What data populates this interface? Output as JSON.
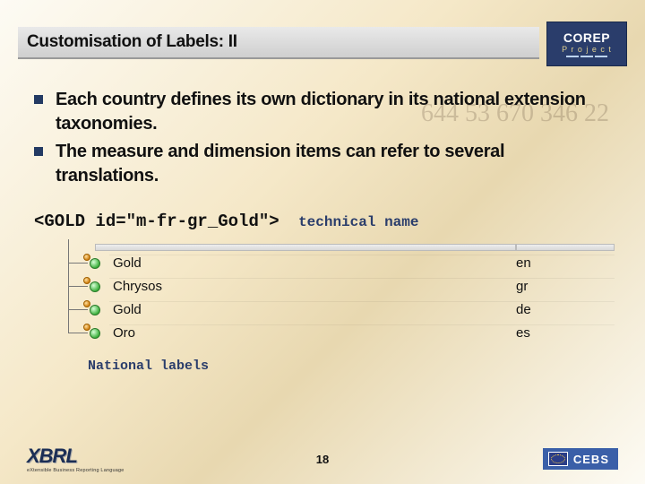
{
  "header": {
    "title": "Customisation of Labels: II",
    "logo_corep_top": "COREP",
    "logo_corep_sub": "P r o j e c t"
  },
  "bullets": [
    "Each country defines its own dictionary in its national extension taxonomies.",
    "The measure and dimension items can refer to several translations."
  ],
  "code": {
    "snippet": "<GOLD id=\"m-fr-gr_Gold\">",
    "annotation": "technical name"
  },
  "labels_table": [
    {
      "label": "Gold",
      "lang": "en"
    },
    {
      "label": "Chrysos",
      "lang": "gr"
    },
    {
      "label": "Gold",
      "lang": "de"
    },
    {
      "label": "Oro",
      "lang": "es"
    }
  ],
  "national_labels_caption": "National labels",
  "footer": {
    "xbrl_main": "XBRL",
    "xbrl_sub": "eXtensible Business Reporting Language",
    "page_number": "18",
    "cebs": "CEBS"
  },
  "bg_numbers": "644\n53\n670\n346\n22"
}
